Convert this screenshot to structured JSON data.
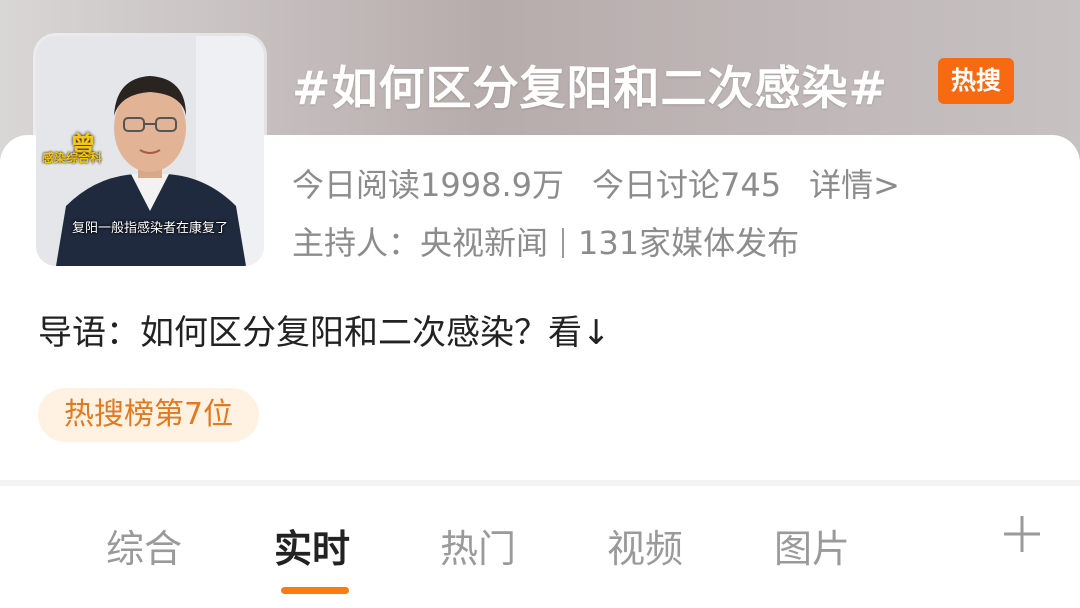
{
  "topic": {
    "title": "#如何区分复阳和二次感染#",
    "hot_badge": "热搜",
    "thumbnail": {
      "caption": "复阳一般指感染者在康复了",
      "badge_char": "曾",
      "badge_label": "感染综合科"
    },
    "stats": {
      "reads": "今日阅读1998.9万",
      "discussions": "今日讨论745",
      "details_link": "详情>"
    },
    "host": {
      "host_label": "主持人：央视新闻",
      "media": "131家媒体发布"
    },
    "intro": "导语：如何区分复阳和二次感染？看↓",
    "rank": "热搜榜第7位"
  },
  "tabs": [
    {
      "label": "综合"
    },
    {
      "label": "实时"
    },
    {
      "label": "热门"
    },
    {
      "label": "视频"
    },
    {
      "label": "图片"
    }
  ],
  "active_tab": "实时",
  "colors": {
    "accent_orange": "#f97b12",
    "hot_badge": "#f86a11",
    "rank_chip_bg": "#fff2e3",
    "rank_chip_text": "#e07a21",
    "muted_text": "#8c8c8c"
  },
  "icons": {
    "add_tab": "plus-icon"
  }
}
